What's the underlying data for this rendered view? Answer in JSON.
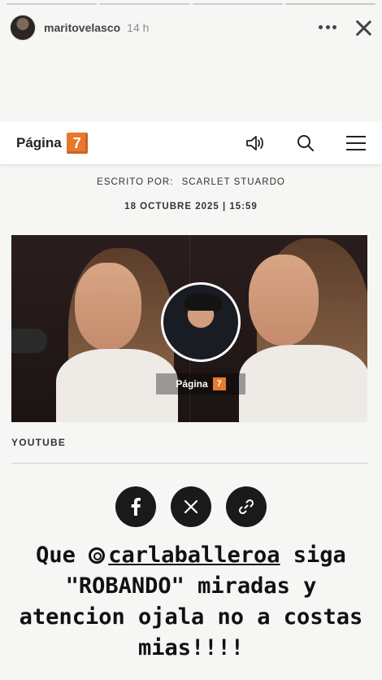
{
  "story": {
    "username": "maritovelasco",
    "time": "14 h",
    "progress": [
      1.0,
      1.0,
      1.0,
      0.0
    ]
  },
  "site": {
    "logo_text": "Página",
    "logo_number": "7",
    "icons": [
      "speaker-icon",
      "search-icon",
      "menu-icon"
    ]
  },
  "article": {
    "author_label": "ESCRITO POR:",
    "author_name": "SCARLET STUARDO",
    "date": "18 OCTUBRE 2025 | 15:59",
    "image_watermark_text": "Página",
    "image_watermark_number": "7",
    "image_credit": "YOUTUBE"
  },
  "share": {
    "icons": [
      "facebook-icon",
      "x-icon",
      "link-icon"
    ]
  },
  "caption": {
    "before": "Que ",
    "mention": "carlaballeroa",
    "after": "  siga \"ROBANDO\" miradas y atencion ojala no a costas mias!!!!"
  },
  "colors": {
    "brand_orange": "#e8782c",
    "share_bg": "#1a1a1a",
    "page_bg": "#f6f6f4"
  }
}
